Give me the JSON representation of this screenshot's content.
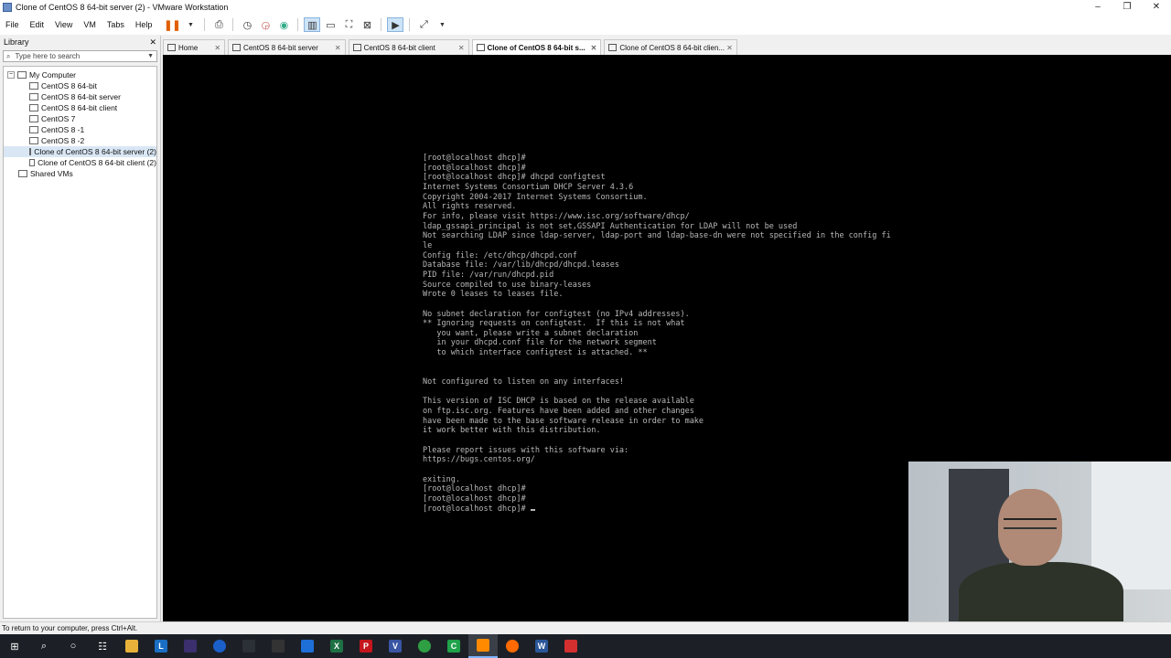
{
  "window": {
    "title": "Clone of CentOS 8 64-bit server (2) - VMware Workstation",
    "controls": [
      "–",
      "❐",
      "✕"
    ]
  },
  "menu": [
    "File",
    "Edit",
    "View",
    "VM",
    "Tabs",
    "Help"
  ],
  "library": {
    "title": "Library",
    "close": "✕",
    "search_placeholder": "Type here to search",
    "root": "My Computer",
    "items": [
      "CentOS 8 64-bit",
      "CentOS 8 64-bit server",
      "CentOS 8 64-bit client",
      "CentOS 7",
      "CentOS 8 -1",
      "CentOS 8 -2",
      "Clone of CentOS 8 64-bit server (2)",
      "Clone of CentOS 8 64-bit client (2)"
    ],
    "shared": "Shared VMs"
  },
  "tabs": [
    {
      "label": "Home",
      "close": "✕"
    },
    {
      "label": "CentOS 8 64-bit server",
      "close": "✕"
    },
    {
      "label": "CentOS 8 64-bit client",
      "close": "✕"
    },
    {
      "label": "Clone of CentOS 8 64-bit s...",
      "close": "✕"
    },
    {
      "label": "Clone of CentOS 8 64-bit clien...",
      "close": "✕"
    }
  ],
  "terminal": {
    "lines": [
      "[root@localhost dhcp]#",
      "[root@localhost dhcp]#",
      "[root@localhost dhcp]# dhcpd configtest",
      "Internet Systems Consortium DHCP Server 4.3.6",
      "Copyright 2004-2017 Internet Systems Consortium.",
      "All rights reserved.",
      "For info, please visit https://www.isc.org/software/dhcp/",
      "ldap_gssapi_principal is not set,GSSAPI Authentication for LDAP will not be used",
      "Not searching LDAP since ldap-server, ldap-port and ldap-base-dn were not specified in the config fi",
      "le",
      "Config file: /etc/dhcp/dhcpd.conf",
      "Database file: /var/lib/dhcpd/dhcpd.leases",
      "PID file: /var/run/dhcpd.pid",
      "Source compiled to use binary-leases",
      "Wrote 0 leases to leases file.",
      "",
      "No subnet declaration for configtest (no IPv4 addresses).",
      "** Ignoring requests on configtest.  If this is not what",
      "   you want, please write a subnet declaration",
      "   in your dhcpd.conf file for the network segment",
      "   to which interface configtest is attached. **",
      "",
      "",
      "Not configured to listen on any interfaces!",
      "",
      "This version of ISC DHCP is based on the release available",
      "on ftp.isc.org. Features have been added and other changes",
      "have been made to the base software release in order to make",
      "it work better with this distribution.",
      "",
      "Please report issues with this software via:",
      "https://bugs.centos.org/",
      "",
      "exiting.",
      "[root@localhost dhcp]#",
      "[root@localhost dhcp]#",
      "[root@localhost dhcp]# "
    ]
  },
  "status": {
    "text": "To return to your computer, press Ctrl+Alt."
  },
  "taskbar": {
    "colors": {
      "background": "#1c2026",
      "vmware": "#ff8a00",
      "excel": "#1e7145",
      "word": "#2b579a",
      "powerpoint": "#d24726",
      "visio": "#3955a3",
      "firefox": "#ff6a00",
      "camtasia": "#1fa34a"
    },
    "icons": [
      "windows-start-icon",
      "search-icon",
      "cortana-icon",
      "task-view-icon",
      "file-explorer-icon",
      "libreoffice-icon",
      "app-icon",
      "webex-icon",
      "vscode-icon",
      "terminal-icon",
      "network-icon",
      "paint-icon",
      "excel-icon",
      "pdf-icon",
      "visio-icon",
      "chrome-icon",
      "camtasia-icon",
      "vmware-icon",
      "firefox-icon",
      "word-icon",
      "capture-icon"
    ],
    "letters": {
      "libreoffice": "L",
      "excel": "X",
      "pdf": "P",
      "visio": "V",
      "word": "W",
      "camtasia": "C"
    }
  }
}
